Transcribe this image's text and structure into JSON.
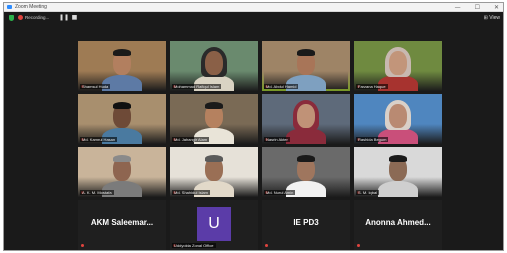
{
  "window": {
    "title": "Zoom Meeting",
    "controls": [
      "—",
      "☐",
      "✕"
    ]
  },
  "toolbar": {
    "recording_label": "Recording...",
    "pause_icon": "pause-icon",
    "stop_icon": "stop-icon",
    "view_label": "⊞ View"
  },
  "participants": [
    {
      "name": "Shamsul Huda",
      "bg": "#9e7b54",
      "skin": "#b27f5f",
      "shirt": "#5d7aa5",
      "hair": "#1a1a1a",
      "headwear": ""
    },
    {
      "name": "Mohammad Rafiqul Islam",
      "bg": "#6a8a6e",
      "skin": "#8a6047",
      "shirt": "#d9d3c3",
      "hair": "#222",
      "headwear": "#2a2a2a"
    },
    {
      "name": "Md. Abdul Hamid",
      "bg": "#9e8466",
      "skin": "#a87558",
      "shirt": "#7ea0c0",
      "hair": "#1a1a1a",
      "headwear": "",
      "active": true
    },
    {
      "name": "Farzana Haque",
      "bg": "#6f8a40",
      "skin": "#c2957a",
      "shirt": "#a7332f",
      "hair": "#cfc3bd",
      "headwear": "#c8b8b0"
    },
    {
      "name": "Md. Kamrul Hasan",
      "bg": "#a88f6e",
      "skin": "#6e4a37",
      "shirt": "#4a7aa0",
      "hair": "#111",
      "headwear": ""
    },
    {
      "name": "Md. Jahangir Alam",
      "bg": "#7a6a55",
      "skin": "#b5815f",
      "shirt": "#e9e4d8",
      "hair": "#1a1a1a",
      "headwear": ""
    },
    {
      "name": "Nasrin Akter",
      "bg": "#5e6a7a",
      "skin": "#c09277",
      "shirt": "#8a2b3b",
      "hair": "#1a1a1a",
      "headwear": "#8a2b3b"
    },
    {
      "name": "Rashida Begum",
      "bg": "#4f86bf",
      "skin": "#b98a72",
      "shirt": "#c94f7a",
      "hair": "#1a1a1a",
      "headwear": "#d9d0c8"
    },
    {
      "name": "A. K. M. Mostafa",
      "bg": "#c9b49a",
      "skin": "#8e6550",
      "shirt": "#7b7b7b",
      "hair": "#8a8a8a",
      "headwear": ""
    },
    {
      "name": "Md. Shahidul Islam",
      "bg": "#e6e1d8",
      "skin": "#9a6f55",
      "shirt": "#e2d9c9",
      "hair": "#5a5a5a",
      "headwear": ""
    },
    {
      "name": "Md. Nurul Amin",
      "bg": "#6a6a6a",
      "skin": "#9f765e",
      "shirt": "#f1f1f1",
      "hair": "#1a1a1a",
      "headwear": ""
    },
    {
      "name": "S. M. Iqbal",
      "bg": "#d9d9d9",
      "skin": "#8b6a55",
      "shirt": "#cfcfcf",
      "hair": "#1a1a1a",
      "headwear": ""
    }
  ],
  "name_tiles": [
    {
      "type": "text",
      "name": "AKM Saleemar..."
    },
    {
      "type": "avatar",
      "initial": "U",
      "name": "Uddyokta Zonal Office"
    },
    {
      "type": "text",
      "name": "IE PD3"
    },
    {
      "type": "text",
      "name": "Anonna Ahmed..."
    }
  ]
}
